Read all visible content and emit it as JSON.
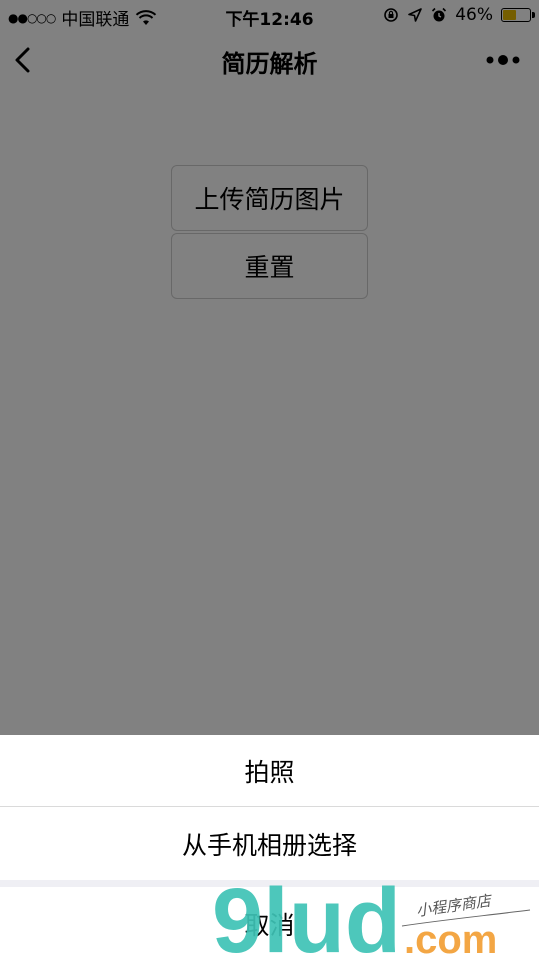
{
  "status_bar": {
    "signal": "●●○○○",
    "carrier": "中国联通",
    "time": "下午12:46",
    "battery_percent": "46%",
    "battery_level": 0.46,
    "icons": [
      "wifi-icon",
      "orientation-lock-icon",
      "location-icon",
      "alarm-icon",
      "battery-icon"
    ]
  },
  "nav": {
    "title": "简历解析",
    "back_icon": "back-chevron-icon",
    "more_icon": "more-dots-icon"
  },
  "page": {
    "upload_label": "上传简历图片",
    "reset_label": "重置"
  },
  "action_sheet": {
    "items": [
      "拍照",
      "从手机相册选择"
    ],
    "cancel": "取消"
  },
  "watermark": {
    "logo_text": "9lud",
    "domain": ".com",
    "slogan": "小程序商店"
  },
  "colors": {
    "overlay": "rgba(0,0,0,0.48)",
    "watermark_teal": "#3ec3b6",
    "watermark_orange": "#f3a23a",
    "battery": "#e0b400"
  }
}
